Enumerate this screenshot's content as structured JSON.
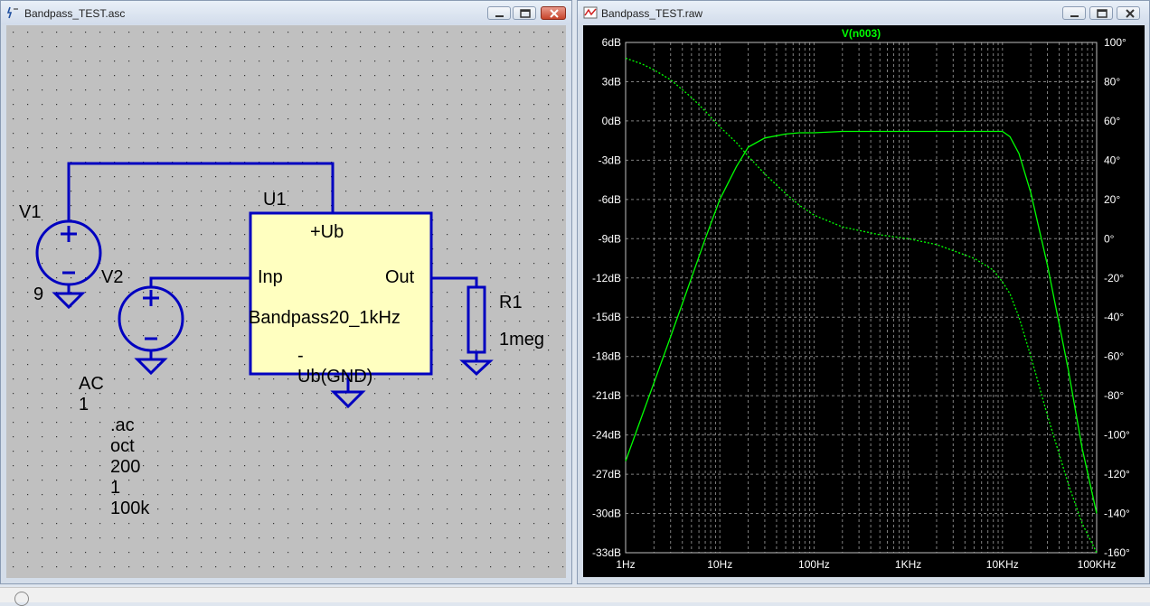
{
  "schematic_window": {
    "title": "Bandpass_TEST.asc",
    "minimize_label": "minimize",
    "restore_label": "restore",
    "close_label": "close",
    "components": {
      "v1_name": "V1",
      "v1_value": "9",
      "v2_name": "V2",
      "v2_value": "AC 1",
      "u1_name": "U1",
      "u1_value": "Bandpass20_1kHz",
      "u1_pin_ub": "+Ub",
      "u1_pin_inp": "Inp",
      "u1_pin_out": "Out",
      "u1_pin_gnd": "-Ub(GND)",
      "r1_name": "R1",
      "r1_value": "1meg"
    },
    "directive": ".ac oct 200 1 100k"
  },
  "waveform_window": {
    "title": "Bandpass_TEST.raw",
    "trace_label": "V(n003)",
    "trace_color": "#00ff00",
    "background_color": "#000000",
    "grid_color": "#808080"
  },
  "chart_data": {
    "type": "line",
    "title": "V(n003)",
    "x_scale": "log",
    "xlim": [
      1,
      100000
    ],
    "x_ticks": [
      "1Hz",
      "10Hz",
      "100Hz",
      "1KHz",
      "10KHz",
      "100KHz"
    ],
    "y_left_ticks": [
      "6dB",
      "3dB",
      "0dB",
      "-3dB",
      "-6dB",
      "-9dB",
      "-12dB",
      "-15dB",
      "-18dB",
      "-21dB",
      "-24dB",
      "-27dB",
      "-30dB",
      "-33dB"
    ],
    "y_left_lim": [
      -33,
      6
    ],
    "y_right_ticks": [
      "100°",
      "80°",
      "60°",
      "40°",
      "20°",
      "0°",
      "-20°",
      "-40°",
      "-60°",
      "-80°",
      "-100°",
      "-120°",
      "-140°",
      "-160°"
    ],
    "y_right_lim": [
      -160,
      100
    ],
    "series": [
      {
        "name": "V(n003)",
        "style": "solid",
        "axis": "left",
        "x": [
          1,
          1.5,
          2,
          3,
          5,
          7,
          10,
          15,
          20,
          30,
          50,
          70,
          100,
          200,
          500,
          1000,
          2000,
          5000,
          8000,
          10000,
          12000,
          15000,
          20000,
          30000,
          50000,
          70000,
          100000
        ],
        "values": [
          -26,
          -22.5,
          -20,
          -16.5,
          -12,
          -9,
          -6,
          -3.5,
          -2,
          -1.3,
          -1,
          -0.9,
          -0.9,
          -0.8,
          -0.8,
          -0.8,
          -0.8,
          -0.8,
          -0.8,
          -0.8,
          -1.2,
          -2.5,
          -5.5,
          -11,
          -19,
          -25,
          -30
        ]
      },
      {
        "name": "V(n003) phase",
        "style": "dotted",
        "axis": "right",
        "x": [
          1,
          1.5,
          2,
          3,
          5,
          7,
          10,
          15,
          20,
          30,
          50,
          70,
          100,
          200,
          500,
          1000,
          2000,
          5000,
          8000,
          10000,
          12000,
          15000,
          20000,
          30000,
          50000,
          70000,
          100000
        ],
        "values": [
          92,
          89,
          86,
          81,
          72,
          65,
          57,
          49,
          42,
          33,
          23,
          17,
          12,
          6,
          2,
          0,
          -3,
          -10,
          -16,
          -22,
          -28,
          -40,
          -60,
          -90,
          -125,
          -145,
          -160
        ]
      }
    ],
    "grid": true
  }
}
